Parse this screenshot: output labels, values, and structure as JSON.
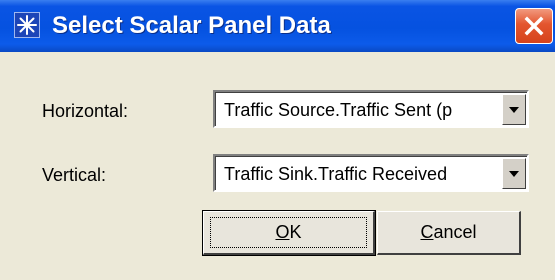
{
  "window": {
    "title": "Select Scalar Panel Data"
  },
  "icons": {
    "app": "star-burst-icon",
    "close": "close-icon",
    "dropdown": "chevron-down-icon"
  },
  "colors": {
    "titlebar": "#0552e0",
    "close_button": "#e3552e",
    "dialog_background": "#ece9d8"
  },
  "form": {
    "horizontal_label": "Horizontal:",
    "horizontal_value": "Traffic Source.Traffic Sent (p",
    "vertical_label": "Vertical:",
    "vertical_value": "Traffic Sink.Traffic Received"
  },
  "buttons": {
    "ok_mnemonic": "O",
    "ok_rest": "K",
    "cancel_mnemonic": "C",
    "cancel_rest": "ancel"
  }
}
